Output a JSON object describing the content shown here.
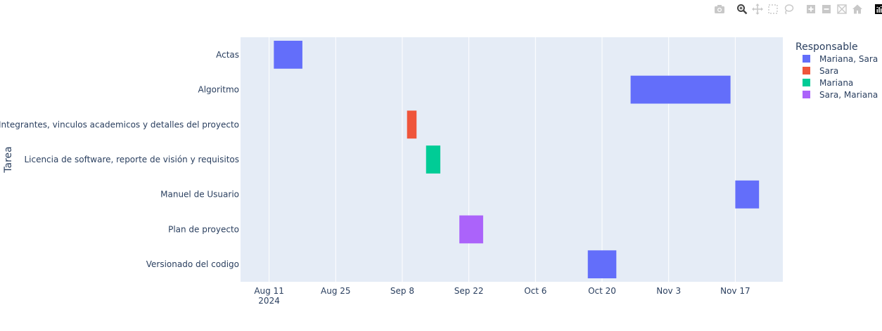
{
  "modebar": {
    "buttons": [
      {
        "icon": "camera-icon",
        "title": "Download plot as a png"
      },
      {
        "icon": "zoom-icon",
        "title": "Zoom"
      },
      {
        "icon": "pan-icon",
        "title": "Pan"
      },
      {
        "icon": "box-select-icon",
        "title": "Box Select"
      },
      {
        "icon": "lasso-select-icon",
        "title": "Lasso Select"
      },
      {
        "icon": "zoom-in-icon",
        "title": "Zoom in"
      },
      {
        "icon": "zoom-out-icon",
        "title": "Zoom out"
      },
      {
        "icon": "autoscale-icon",
        "title": "Autoscale"
      },
      {
        "icon": "reset-axes-icon",
        "title": "Reset axes"
      },
      {
        "icon": "plotly-logo-icon",
        "title": "Produced with Plotly"
      }
    ]
  },
  "chart_data": {
    "type": "bar",
    "orientation": "gantt",
    "title": "",
    "xlabel": "",
    "ylabel": "Tarea",
    "xlim": [
      "2024-08-05",
      "2024-11-27"
    ],
    "x_ticks": [
      {
        "date": "2024-08-11",
        "label": "Aug 11",
        "sublabel": "2024"
      },
      {
        "date": "2024-08-25",
        "label": "Aug 25",
        "sublabel": ""
      },
      {
        "date": "2024-09-08",
        "label": "Sep 8",
        "sublabel": ""
      },
      {
        "date": "2024-09-22",
        "label": "Sep 22",
        "sublabel": ""
      },
      {
        "date": "2024-10-06",
        "label": "Oct 6",
        "sublabel": ""
      },
      {
        "date": "2024-10-20",
        "label": "Oct 20",
        "sublabel": ""
      },
      {
        "date": "2024-11-03",
        "label": "Nov 3",
        "sublabel": ""
      },
      {
        "date": "2024-11-17",
        "label": "Nov 17",
        "sublabel": ""
      }
    ],
    "categories": [
      "Actas",
      "Algoritmo",
      "Integrantes, vinculos academicos y detalles del proyecto",
      "Licencia de software, reporte de visión y requisitos",
      "Manuel de Usuario",
      "Plan de proyecto",
      "Versionado del codigo"
    ],
    "tasks": [
      {
        "task": "Actas",
        "start": "2024-08-12",
        "end": "2024-08-18",
        "responsable": "Mariana, Sara"
      },
      {
        "task": "Algoritmo",
        "start": "2024-10-26",
        "end": "2024-11-16",
        "responsable": "Mariana, Sara"
      },
      {
        "task": "Integrantes, vinculos academicos y detalles del proyecto",
        "start": "2024-09-09",
        "end": "2024-09-11",
        "responsable": "Sara"
      },
      {
        "task": "Licencia de software, reporte de visión y requisitos",
        "start": "2024-09-13",
        "end": "2024-09-16",
        "responsable": "Mariana"
      },
      {
        "task": "Manuel de Usuario",
        "start": "2024-11-17",
        "end": "2024-11-22",
        "responsable": "Mariana, Sara"
      },
      {
        "task": "Plan de proyecto",
        "start": "2024-09-20",
        "end": "2024-09-25",
        "responsable": "Sara, Mariana"
      },
      {
        "task": "Versionado del codigo",
        "start": "2024-10-17",
        "end": "2024-10-23",
        "responsable": "Mariana, Sara"
      }
    ],
    "legend": {
      "title": "Responsable",
      "placement": "right",
      "items": [
        {
          "name": "Mariana, Sara",
          "color": "#636efa"
        },
        {
          "name": "Sara",
          "color": "#ef553b"
        },
        {
          "name": "Mariana",
          "color": "#00cc96"
        },
        {
          "name": "Sara, Mariana",
          "color": "#ab63fa"
        }
      ]
    },
    "grid": true,
    "plot_bgcolor": "#e5ecf6",
    "gridcolor": "#ffffff"
  }
}
